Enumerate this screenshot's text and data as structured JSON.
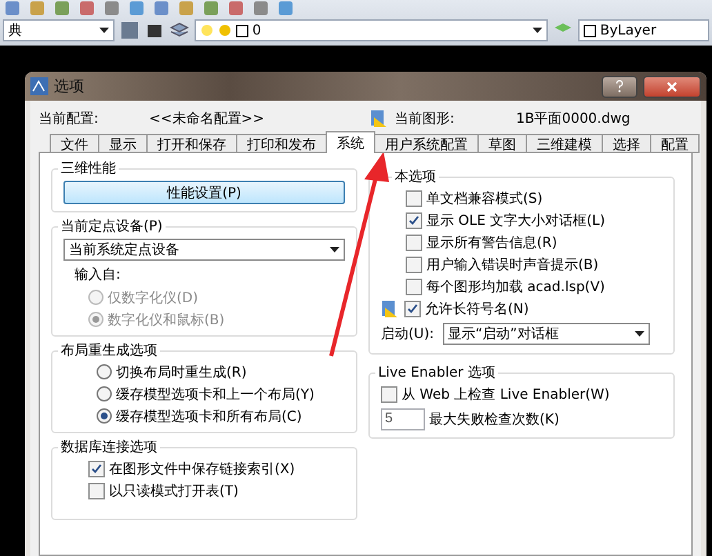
{
  "toolbar": {
    "style_combo": "典",
    "layer_combo": "0",
    "color_combo": "ByLayer"
  },
  "window": {
    "title": "选项"
  },
  "header": {
    "profile_label": "当前配置:",
    "profile": "<<未命名配置>>",
    "drawing_label": "当前图形:",
    "drawing": "1B平面0000.dwg"
  },
  "tabs": [
    {
      "label": "文件",
      "selected": false
    },
    {
      "label": "显示",
      "selected": false
    },
    {
      "label": "打开和保存",
      "selected": false
    },
    {
      "label": "打印和发布",
      "selected": false
    },
    {
      "label": "系统",
      "selected": true
    },
    {
      "label": "用户系统配置",
      "selected": false
    },
    {
      "label": "草图",
      "selected": false
    },
    {
      "label": "三维建模",
      "selected": false
    },
    {
      "label": "选择",
      "selected": false
    },
    {
      "label": "配置",
      "selected": false
    }
  ],
  "performance": {
    "title": "三维性能",
    "button": "性能设置(P)"
  },
  "pointing": {
    "title": "当前定点设备(P)",
    "device": "当前系统定点设备",
    "input_label": "输入自:",
    "options": [
      {
        "label": "仅数字化仪(D)",
        "selected": false,
        "disabled": true
      },
      {
        "label": "数字化仪和鼠标(B)",
        "selected": true,
        "disabled": true
      }
    ]
  },
  "layout_regen": {
    "title": "布局重生成选项",
    "options": [
      {
        "label": "切换布局时重生成(R)",
        "selected": false
      },
      {
        "label": "缓存模型选项卡和上一个布局(Y)",
        "selected": false
      },
      {
        "label": "缓存模型选项卡和所有布局(C)",
        "selected": true
      }
    ]
  },
  "db_connect": {
    "title": "数据库连接选项",
    "options": [
      {
        "label": "在图形文件中保存链接索引(X)",
        "checked": true
      },
      {
        "label": "以只读模式打开表(T)",
        "checked": false
      }
    ]
  },
  "general": {
    "title": "本选项",
    "options": [
      {
        "label": "单文档兼容模式(S)",
        "checked": false,
        "kind": "plain"
      },
      {
        "label": "显示 OLE 文字大小对话框(L)",
        "checked": true,
        "kind": "plain"
      },
      {
        "label": "显示所有警告信息(R)",
        "checked": false,
        "kind": "plain"
      },
      {
        "label": "用户输入错误时声音提示(B)",
        "checked": false,
        "kind": "plain"
      },
      {
        "label": "每个图形均加载 acad.lsp(V)",
        "checked": false,
        "kind": "plain"
      },
      {
        "label": "允许长符号名(N)",
        "checked": true,
        "kind": "icon"
      }
    ],
    "startup_label": "启动(U):",
    "startup": "显示“启动”对话框"
  },
  "live_enabler": {
    "title": "Live Enabler 选项",
    "check": {
      "label": "从 Web 上检查 Live Enabler(W)",
      "checked": false
    },
    "max_value": "5",
    "max_label": "最大失败检查次数(K)"
  }
}
